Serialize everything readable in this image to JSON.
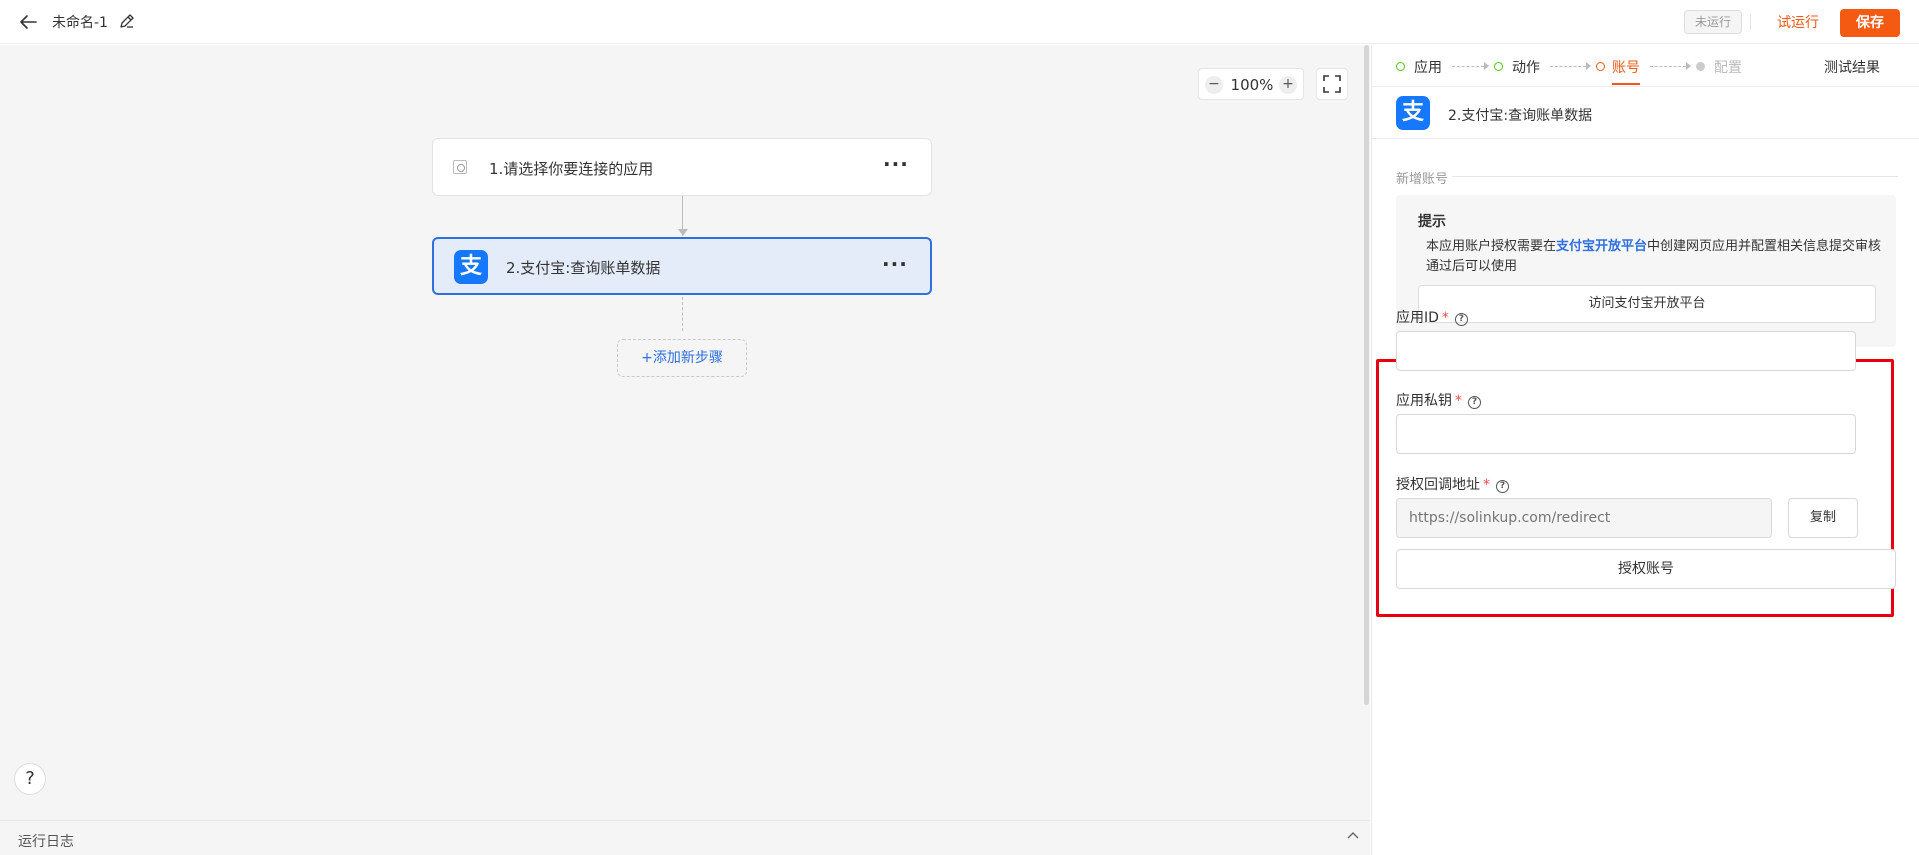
{
  "header": {
    "title": "未命名-1",
    "status": "未运行",
    "trial_run": "试运行",
    "save": "保存"
  },
  "canvas": {
    "zoom": "100%",
    "zoom_minus": "−",
    "zoom_plus": "+",
    "nodes": [
      {
        "label": "1.请选择你要连接的应用",
        "more": "···"
      },
      {
        "label": "2.支付宝:查询账单数据",
        "more": "···",
        "icon_text": "支"
      }
    ],
    "add_step": "+添加新步骤",
    "help": "?"
  },
  "log_bar": {
    "label": "运行日志"
  },
  "panel": {
    "steps": [
      {
        "label": "应用",
        "state": "done"
      },
      {
        "label": "动作",
        "state": "done"
      },
      {
        "label": "账号",
        "state": "active"
      },
      {
        "label": "配置",
        "state": "disabled"
      }
    ],
    "test_result": "测试结果",
    "app_title": "2.支付宝:查询账单数据",
    "app_icon_text": "支",
    "new_account": "新增账号",
    "hint": {
      "title": "提示",
      "text_before": "本应用账户授权需要在",
      "link": "支付宝开放平台",
      "text_after": "中创建网页应用并配置相关信息提交审核通过后可以使用",
      "visit_button": "访问支付宝开放平台"
    },
    "fields": {
      "app_id_label": "应用ID",
      "app_id_value": "",
      "private_key_label": "应用私钥",
      "private_key_value": "",
      "callback_label": "授权回调地址",
      "callback_placeholder": "https://solinkup.com/redirect",
      "required_mark": "*",
      "help_mark": "?",
      "copy": "复制"
    },
    "authorize_button": "授权账号"
  },
  "colors": {
    "accent": "#f45a12",
    "link": "#2f6fe0",
    "alipay": "#1677ff",
    "highlight_box": "#e60012",
    "step_done": "#52c41a"
  },
  "icons": [
    "back-arrow-icon",
    "edit-icon",
    "fullscreen-icon",
    "app-icon",
    "alipay-icon",
    "more-icon",
    "help-icon",
    "chevron-up-icon"
  ]
}
